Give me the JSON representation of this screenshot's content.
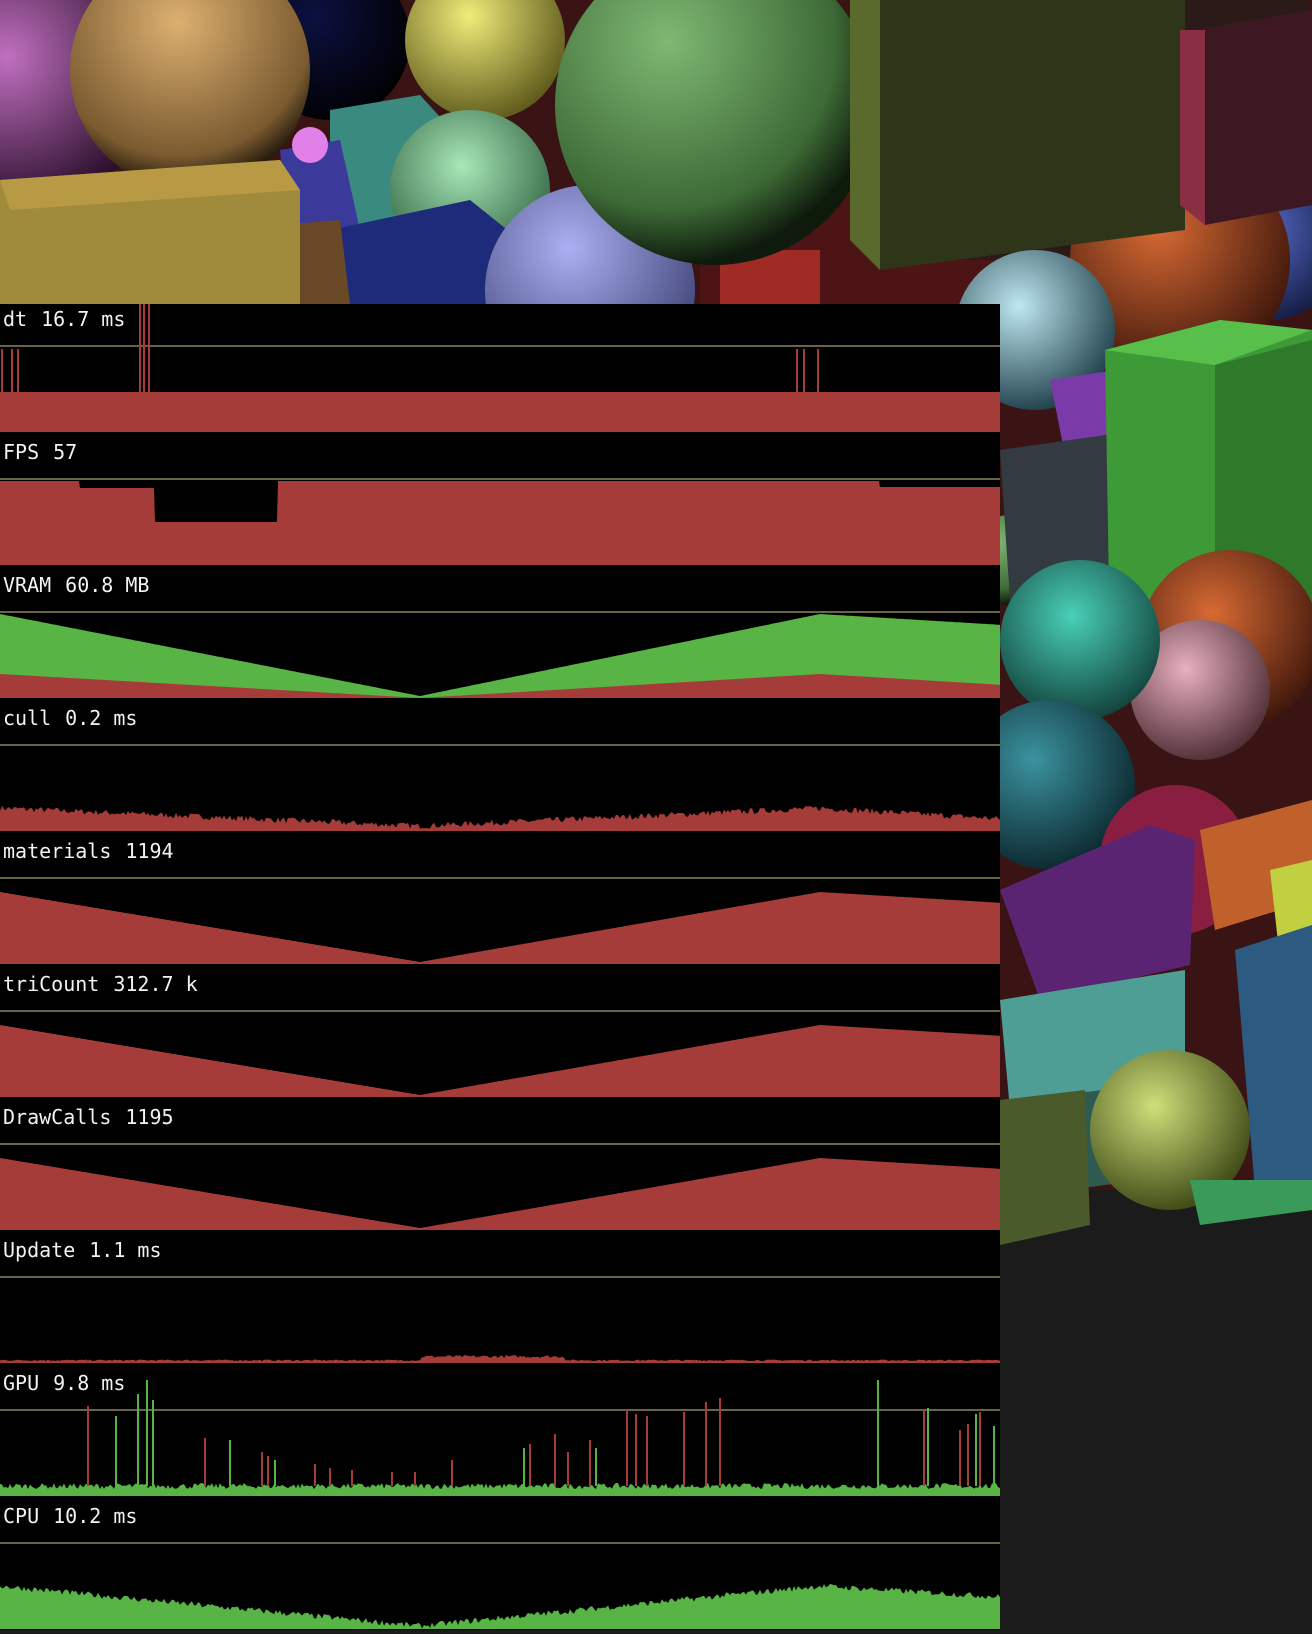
{
  "stats": [
    {
      "key": "dt",
      "label": "dt",
      "value": "16.7 ms",
      "shape": "dt"
    },
    {
      "key": "fps",
      "label": "FPS",
      "value": "57",
      "shape": "fps"
    },
    {
      "key": "vram",
      "label": "VRAM",
      "value": "60.8 MB",
      "shape": "vram"
    },
    {
      "key": "cull",
      "label": "cull",
      "value": "0.2 ms",
      "shape": "cull"
    },
    {
      "key": "materials",
      "label": "materials",
      "value": "1194",
      "shape": "tri"
    },
    {
      "key": "tricount",
      "label": "triCount",
      "value": "312.7 k",
      "shape": "tri"
    },
    {
      "key": "drawcalls",
      "label": "DrawCalls",
      "value": "1195",
      "shape": "tri"
    },
    {
      "key": "update",
      "label": "Update",
      "value": "1.1 ms",
      "shape": "update"
    },
    {
      "key": "gpu",
      "label": "GPU",
      "value": "9.8 ms",
      "shape": "gpu"
    },
    {
      "key": "cpu",
      "label": "CPU",
      "value": "10.2 ms",
      "shape": "cpu"
    }
  ],
  "colors": {
    "panel_bg": "#000000",
    "label_text": "#f2f2f2",
    "guide_line": "#8a8560",
    "series_red": "#a53c39",
    "series_green": "#58b444",
    "viewport_bg": "#1b1b1b"
  },
  "scene": {
    "objects": [
      {
        "kind": "sphere",
        "color": "#6fa865",
        "name": "green-sphere"
      },
      {
        "kind": "sphere",
        "color": "#c9a064",
        "name": "tan-sphere"
      },
      {
        "kind": "sphere",
        "color": "#9b4f9e",
        "name": "magenta-sphere"
      },
      {
        "kind": "sphere",
        "color": "#d6d24f",
        "name": "yellow-sphere"
      },
      {
        "kind": "sphere",
        "color": "#9aa1e6",
        "name": "lavender-sphere"
      },
      {
        "kind": "sphere",
        "color": "#8fd4a2",
        "name": "mint-sphere"
      },
      {
        "kind": "sphere",
        "color": "#9fd6e6",
        "name": "light-blue-sphere"
      },
      {
        "kind": "sphere",
        "color": "#3cb8a4",
        "name": "teal-sphere"
      },
      {
        "kind": "sphere",
        "color": "#2f7f8c",
        "name": "dark-teal-sphere"
      },
      {
        "kind": "sphere",
        "color": "#d897a8",
        "name": "pink-sphere"
      },
      {
        "kind": "sphere",
        "color": "#b9d066",
        "name": "lime-sphere"
      },
      {
        "kind": "sphere",
        "color": "#c0582c",
        "name": "orange-sphere"
      },
      {
        "kind": "cube",
        "color": "#5a6a2c",
        "name": "olive-cube"
      },
      {
        "kind": "cube",
        "color": "#8a2e44",
        "name": "maroon-cube"
      },
      {
        "kind": "cube",
        "color": "#4aa53e",
        "name": "green-cube"
      },
      {
        "kind": "cube",
        "color": "#5b2472",
        "name": "purple-cube"
      },
      {
        "kind": "cube",
        "color": "#4e9e96",
        "name": "teal-cube"
      },
      {
        "kind": "cube",
        "color": "#a08a3c",
        "name": "gold-cube"
      },
      {
        "kind": "cube",
        "color": "#2a3a7a",
        "name": "navy-cube"
      },
      {
        "kind": "cube",
        "color": "#2d5a80",
        "name": "blue-cube"
      }
    ]
  }
}
